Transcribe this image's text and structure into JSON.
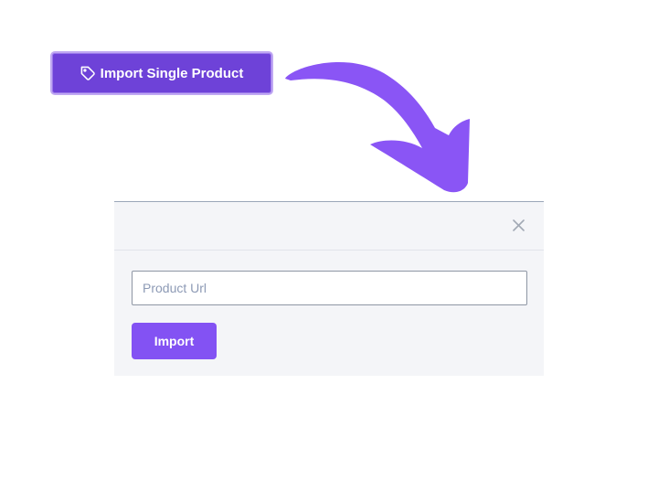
{
  "trigger": {
    "label": "Import Single Product",
    "icon": "tag-icon"
  },
  "modal": {
    "close_icon": "close-icon",
    "input": {
      "placeholder": "Product Url",
      "value": ""
    },
    "submit_label": "Import"
  },
  "decor": {
    "arrow_icon": "curved-arrow-icon",
    "arrow_color": "#8a55f5"
  },
  "colors": {
    "trigger_bg": "#6e42d8",
    "trigger_border": "#c0a8f2",
    "submit_bg": "#8352f3",
    "modal_bg": "#f4f5f8"
  }
}
